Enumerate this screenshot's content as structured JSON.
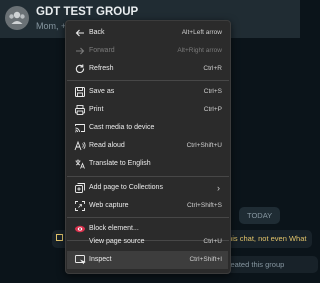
{
  "chat": {
    "title": "GDT TEST GROUP",
    "subtitle": "Mom, +91",
    "today_badge": "TODAY",
    "e2e_notice": "this chat, not even What",
    "created_notice": "u created this group"
  },
  "menu": {
    "items": [
      {
        "label": "Back",
        "shortcut": "Alt+Left arrow",
        "icon": "back-arrow-icon",
        "disabled": false
      },
      {
        "label": "Forward",
        "shortcut": "Alt+Right arrow",
        "icon": "forward-arrow-icon",
        "disabled": true
      },
      {
        "label": "Refresh",
        "shortcut": "Ctrl+R",
        "icon": "refresh-icon",
        "disabled": false
      },
      {
        "label": "Save as",
        "shortcut": "Ctrl+S",
        "icon": "save-icon",
        "disabled": false
      },
      {
        "label": "Print",
        "shortcut": "Ctrl+P",
        "icon": "print-icon",
        "disabled": false
      },
      {
        "label": "Cast media to device",
        "shortcut": "",
        "icon": "cast-icon",
        "disabled": false
      },
      {
        "label": "Read aloud",
        "shortcut": "Ctrl+Shift+U",
        "icon": "read-aloud-icon",
        "disabled": false
      },
      {
        "label": "Translate to English",
        "shortcut": "",
        "icon": "translate-icon",
        "disabled": false
      },
      {
        "label": "Add page to Collections",
        "shortcut": "",
        "icon": "collections-icon",
        "disabled": false
      },
      {
        "label": "Web capture",
        "shortcut": "Ctrl+Shift+S",
        "icon": "web-capture-icon",
        "disabled": false
      },
      {
        "label": "Block element...",
        "shortcut": "",
        "icon": "block-element-icon",
        "disabled": false
      },
      {
        "label": "View page source",
        "shortcut": "Ctrl+U",
        "icon": "",
        "disabled": false
      },
      {
        "label": "Inspect",
        "shortcut": "Ctrl+Shift+I",
        "icon": "inspect-icon",
        "disabled": false
      }
    ]
  },
  "colors": {
    "menu_background": "#2b2b2b",
    "menu_highlight": "#3d3d3d",
    "chat_header": "#202c33",
    "chat_background": "#0b141a",
    "notice_text": "#e2c46a",
    "block_icon": "#d9304c"
  }
}
